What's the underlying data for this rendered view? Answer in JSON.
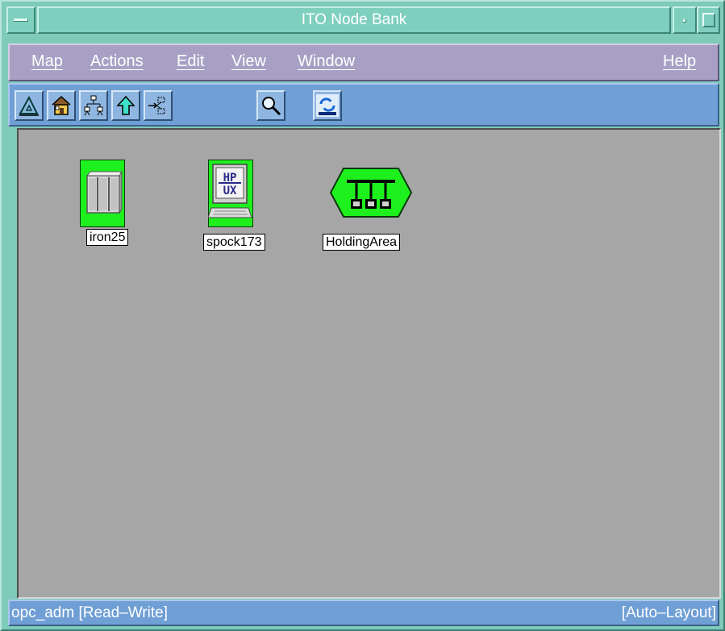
{
  "window": {
    "title": "ITO Node Bank"
  },
  "menubar": {
    "items": [
      {
        "label": "Map"
      },
      {
        "label": "Actions"
      },
      {
        "label": "Edit"
      },
      {
        "label": "View"
      },
      {
        "label": "Window"
      }
    ],
    "help_label": "Help"
  },
  "toolbar": {
    "tools": [
      {
        "icon": "triangle-ruler-icon"
      },
      {
        "icon": "home-icon"
      },
      {
        "icon": "hierarchy-icon"
      },
      {
        "icon": "up-arrow-icon"
      },
      {
        "icon": "branch-arrows-icon"
      },
      {
        "icon": "magnifier-icon"
      },
      {
        "icon": "hp-openview-logo-icon"
      }
    ]
  },
  "map": {
    "background": "#a6a6a6",
    "status_color": "#1ef01e",
    "nodes": [
      {
        "label": "iron25",
        "icon": "server-cabinet-icon"
      },
      {
        "label": "spock173",
        "icon": "hpux-workstation-icon"
      },
      {
        "label": "HoldingArea",
        "icon": "network-bus-icon"
      }
    ]
  },
  "statusbar": {
    "left": "opc_adm [Read–Write]",
    "right": "[Auto–Layout]"
  },
  "colors": {
    "titlebar": "#7fcfbe",
    "menubar": "#a8a0c4",
    "toolbar": "#6f9fd4"
  }
}
